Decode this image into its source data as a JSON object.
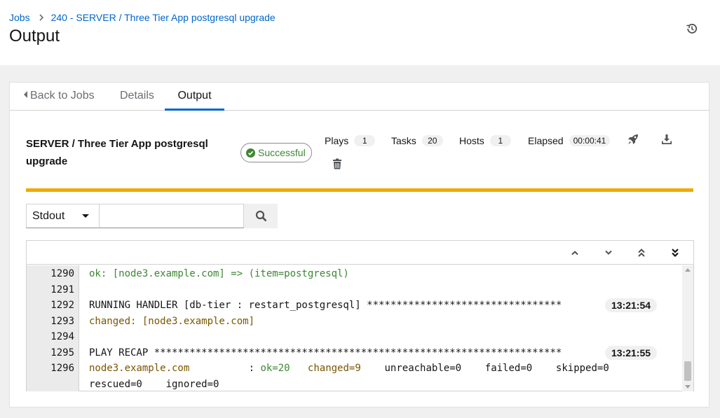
{
  "breadcrumb": {
    "jobs_link": "Jobs",
    "current": "240 - SERVER / Three Tier App postgresql upgrade"
  },
  "page": {
    "title": "Output"
  },
  "tabs": {
    "back": "Back to Jobs",
    "details": "Details",
    "output": "Output"
  },
  "job": {
    "name": "SERVER / Three Tier App postgresql upgrade",
    "status": "Successful",
    "status_color": "#3e8635",
    "progress_percent": 100,
    "progress_color": "#f0ab00"
  },
  "stats": {
    "plays_label": "Plays",
    "plays": "1",
    "tasks_label": "Tasks",
    "tasks": "20",
    "hosts_label": "Hosts",
    "hosts": "1",
    "elapsed_label": "Elapsed",
    "elapsed": "00:00:41"
  },
  "actions": {
    "relaunch_icon": "rocket-icon",
    "download_icon": "download-icon",
    "delete_icon": "trash-icon"
  },
  "toolbar": {
    "filter_selected": "Stdout",
    "search_placeholder": "",
    "search_icon": "search-icon"
  },
  "log": {
    "lines": [
      {
        "num": "1290",
        "segments": [
          {
            "text": "ok: [node3.example.com] => (item=postgresql)",
            "cls": "ok"
          }
        ],
        "timestamp": ""
      },
      {
        "num": "1291",
        "segments": [],
        "timestamp": ""
      },
      {
        "num": "1292",
        "segments": [
          {
            "text": "RUNNING HANDLER [db-tier : restart_postgresql] *********************************",
            "cls": "plain"
          }
        ],
        "timestamp": "13:21:54"
      },
      {
        "num": "1293",
        "segments": [
          {
            "text": "changed: [node3.example.com]",
            "cls": "changed"
          }
        ],
        "timestamp": ""
      },
      {
        "num": "1294",
        "segments": [],
        "timestamp": ""
      },
      {
        "num": "1295",
        "segments": [
          {
            "text": "PLAY RECAP *********************************************************************",
            "cls": "plain"
          }
        ],
        "timestamp": "13:21:55"
      },
      {
        "num": "1296",
        "segments": [
          {
            "text": "node3.example.com",
            "cls": "changed"
          },
          {
            "text": "          : ",
            "cls": "plain"
          },
          {
            "text": "ok=20",
            "cls": "ok"
          },
          {
            "text": "   ",
            "cls": "plain"
          },
          {
            "text": "changed=9",
            "cls": "changed"
          },
          {
            "text": "    unreachable=0    failed=0    skipped=0",
            "cls": "plain"
          }
        ],
        "timestamp": ""
      },
      {
        "num": "",
        "segments": [
          {
            "text": "rescued=0    ignored=0",
            "cls": "plain"
          }
        ],
        "timestamp": ""
      }
    ]
  }
}
